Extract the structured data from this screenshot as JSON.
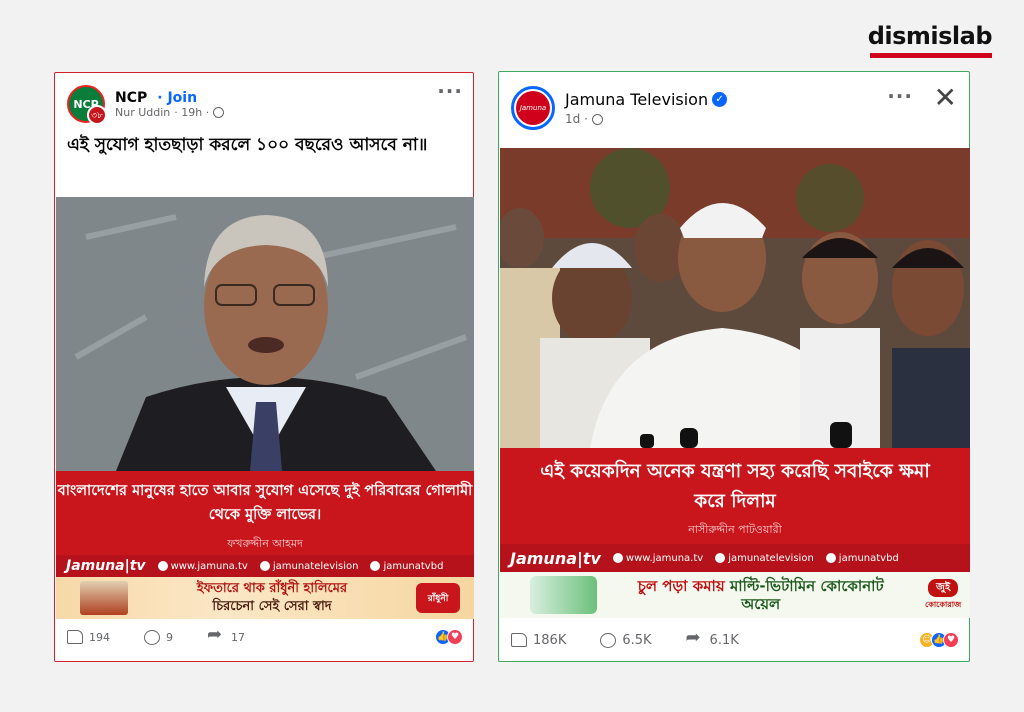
{
  "watermark": {
    "text": "dismislab"
  },
  "left_post": {
    "group_name": "NCP",
    "join_label": "· Join",
    "author": "Nur Uddin",
    "time": "· 19h ·",
    "avatar_text": "NCP",
    "avatar_badge": "৩৮",
    "more_icon": "ellipsis-icon",
    "caption": "এই সুযোগ হাতছাড়া করলে ১০০ বছরেও আসবে না॥",
    "banner_text": "বাংলাদেশের মানুষের হাতে আবার সুযোগ এসেছে দুই পরিবারের গোলামী থেকে মুক্তি লাভের।",
    "speaker": "ফখরুদ্দীন আহমদ",
    "brand": "Jamuna|tv",
    "links": {
      "web": "www.jamuna.tv",
      "fb": "jamunatelevision",
      "yt": "jamunatvbd"
    },
    "ad_line1": "ইফতারে থাক রাঁধুনী হালিমের",
    "ad_line2": "চিরচেনা সেই সেরা স্বাদ",
    "ad_logo": "রাঁধুনী",
    "likes": "194",
    "comments": "9",
    "shares": "17"
  },
  "right_post": {
    "page_name": "Jamuna Television",
    "time": "1d ·",
    "avatar_text": "Jamuna",
    "verified_icon": "✓",
    "more_icon": "ellipsis-icon",
    "close_icon": "close-icon",
    "banner_text": "এই কয়েকদিন অনেক যন্ত্রণা সহ্য করেছি সবাইকে ক্ষমা করে দিলাম",
    "speaker": "নাসীরুদ্দীন পাটওয়ারী",
    "brand": "Jamuna|tv",
    "links": {
      "web": "www.jamuna.tv",
      "fb": "jamunatelevision",
      "yt": "jamunatvbd"
    },
    "ad_text_red": "চুল পড়া কমায়",
    "ad_text_green": "মাল্টি-ভিটামিন কোকোনাট অয়েল",
    "ad_brand": "কোকোরাজ",
    "ad_brand_badge": "জুই",
    "likes": "186K",
    "comments": "6.5K",
    "shares": "6.1K"
  },
  "colors": {
    "jamuna_red": "#c8161c",
    "fb_blue": "#0866ff",
    "left_border": "#d1232a",
    "right_border": "#41a85f"
  }
}
